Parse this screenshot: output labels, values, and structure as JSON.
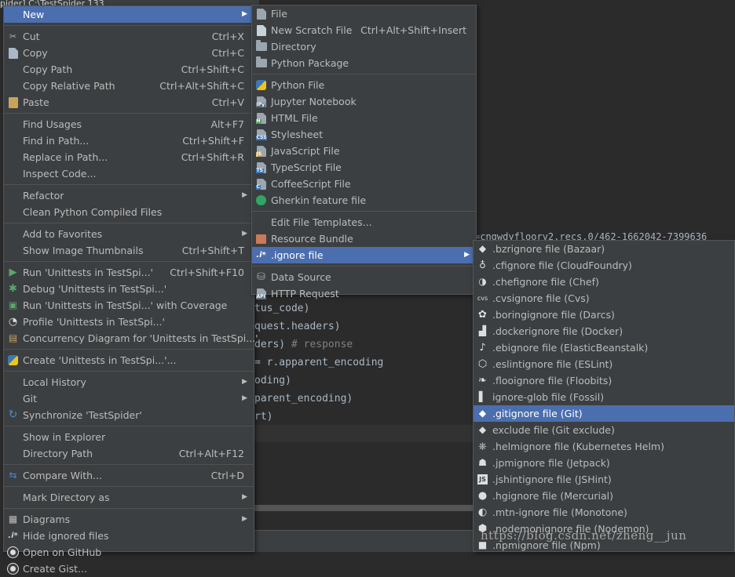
{
  "project": {
    "title": "pider] C:\\TestSpider",
    "num": "133"
  },
  "code_lines": [
    {
      "text": "tus_code)",
      "comment": ""
    },
    {
      "text": "quest.headers)",
      "comment": ""
    },
    {
      "text": "ders)    ",
      "comment": "# response"
    },
    {
      "text": "= r.apparent_encoding",
      "comment": ""
    },
    {
      "text": "oding)",
      "comment": ""
    },
    {
      "text": "parent_encoding)",
      "comment": ""
    },
    {
      "text": "rt)",
      "comment": ""
    }
  ],
  "url_fragment": "=cngwdyfloorv2.recs.0/462-1662042-7399636",
  "watermark": "https://blog.csdn.net/zheng__jun",
  "context_menu": {
    "new": "New",
    "cut": {
      "label": "Cut",
      "mn": "t",
      "pre": "Cu",
      "sc": "Ctrl+X"
    },
    "copy": {
      "label": "Copy",
      "sc": "Ctrl+C"
    },
    "copy_path": {
      "label": "Copy Path",
      "sc": "Ctrl+Shift+C"
    },
    "copy_rel": {
      "label": "Copy Relative Path",
      "sc": "Ctrl+Alt+Shift+C"
    },
    "paste": {
      "label": "Paste",
      "sc": "Ctrl+V"
    },
    "find_usages": {
      "label": "Find Usages",
      "sc": "Alt+F7"
    },
    "find_in_path": {
      "label": "Find in Path...",
      "sc": "Ctrl+Shift+F"
    },
    "replace_in_path": {
      "label": "Replace in Path...",
      "sc": "Ctrl+Shift+R"
    },
    "inspect": {
      "label": "Inspect Code..."
    },
    "refactor": {
      "label": "Refactor"
    },
    "clean": {
      "label": "Clean Python Compiled Files"
    },
    "add_fav": {
      "label": "Add to Favorites"
    },
    "thumbs": {
      "label": "Show Image Thumbnails",
      "sc": "Ctrl+Shift+T"
    },
    "run": {
      "label": "Run 'Unittests in TestSpi...'",
      "sc": "Ctrl+Shift+F10"
    },
    "debug": {
      "label": "Debug 'Unittests in TestSpi...'"
    },
    "coverage": {
      "label": "Run 'Unittests in TestSpi...' with Coverage"
    },
    "profile": {
      "label": "Profile 'Unittests in TestSpi...'"
    },
    "concurrency": {
      "label": "Concurrency Diagram for 'Unittests in TestSpi...'"
    },
    "create": {
      "label": "Create 'Unittests in TestSpi...'..."
    },
    "local_history": {
      "label": "Local History"
    },
    "git": {
      "label": "Git"
    },
    "sync": {
      "label": "Synchronize 'TestSpider'"
    },
    "explorer": {
      "label": "Show in Explorer"
    },
    "dir_path": {
      "label": "Directory Path",
      "sc": "Ctrl+Alt+F12"
    },
    "compare": {
      "label": "Compare With...",
      "sc": "Ctrl+D"
    },
    "mark_dir": {
      "label": "Mark Directory as"
    },
    "diagrams": {
      "label": "Diagrams"
    },
    "hide_ignored": {
      "label": "Hide ignored files"
    },
    "open_github": {
      "label": "Open on GitHub"
    },
    "create_gist": {
      "label": "Create Gist..."
    }
  },
  "new_menu": {
    "file": "File",
    "scratch": {
      "label": "New Scratch File",
      "sc": "Ctrl+Alt+Shift+Insert"
    },
    "directory": "Directory",
    "py_package": "Python Package",
    "py_file": "Python File",
    "jupyter": "Jupyter Notebook",
    "html": "HTML File",
    "stylesheet": "Stylesheet",
    "js": "JavaScript File",
    "ts": "TypeScript File",
    "coffee": "CoffeeScript File",
    "gherkin": "Gherkin feature file",
    "edit_templates": "Edit File Templates...",
    "resource_bundle": "Resource Bundle",
    "ignore_file": ".ignore file",
    "data_source": "Data Source",
    "http_request": "HTTP Request"
  },
  "ignore_menu": [
    ".bzrignore file (Bazaar)",
    ".cfignore file (CloudFoundry)",
    ".chefignore file (Chef)",
    ".cvsignore file (Cvs)",
    ".boringignore file (Darcs)",
    ".dockerignore file (Docker)",
    ".ebignore file (ElasticBeanstalk)",
    ".eslintignore file (ESLint)",
    ".flooignore file (Floobits)",
    "ignore-glob file (Fossil)",
    ".gitignore file (Git)",
    "exclude file (Git exclude)",
    ".helmignore file (Kubernetes Helm)",
    ".jpmignore file (Jetpack)",
    ".jshintignore file (JSHint)",
    ".hgignore file (Mercurial)",
    ".mtn-ignore file (Monotone)",
    ".nodemonignore file (Nodemon)",
    ".npmignore file (Npm)"
  ],
  "colors": {
    "menu_bg": "#3c3f41",
    "selection": "#4b6eaf",
    "editor_bg": "#2b2b2b"
  }
}
